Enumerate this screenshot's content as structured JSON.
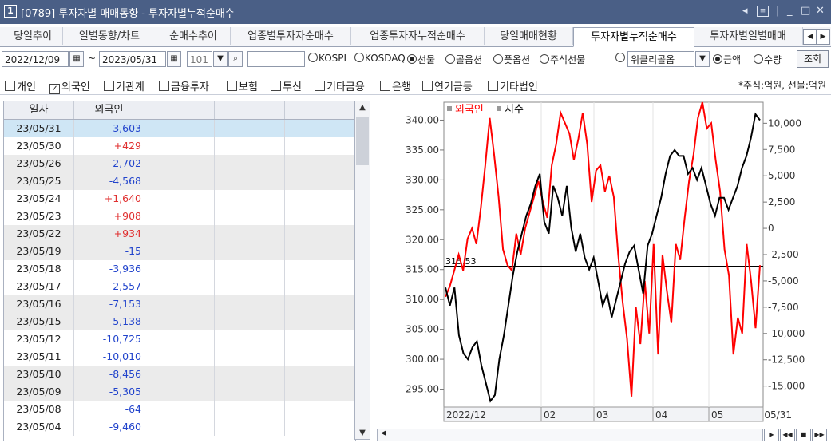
{
  "window": {
    "number": "1",
    "title": "[0789] 투자자별 매매동향 - 투자자별누적순매수"
  },
  "tabs": [
    {
      "label": "당일추이",
      "active": false
    },
    {
      "label": "일별동향/차트",
      "active": false
    },
    {
      "label": "순매수추이",
      "active": false
    },
    {
      "label": "업종별투자자순매수",
      "active": false
    },
    {
      "label": "업종투자자누적순매수",
      "active": false
    },
    {
      "label": "당일매매현황",
      "active": false
    },
    {
      "label": "투자자별누적순매수",
      "active": true
    },
    {
      "label": "투자자별일별매매",
      "active": false
    }
  ],
  "controls": {
    "start_date": "2022/12/09",
    "separator": "~",
    "end_date": "2023/05/31",
    "code": "101",
    "name_field": "",
    "market_options": [
      {
        "label": "KOSPI",
        "selected": false
      },
      {
        "label": "KOSDAQ",
        "selected": false
      },
      {
        "label": "선물",
        "selected": true
      },
      {
        "label": "콜옵션",
        "selected": false
      },
      {
        "label": "풋옵션",
        "selected": false
      },
      {
        "label": "주식선물",
        "selected": false
      }
    ],
    "weekly_option": "위클리콜옵",
    "unit_options": [
      {
        "label": "금액",
        "selected": true
      },
      {
        "label": "수량",
        "selected": false
      }
    ],
    "query_label": "조회"
  },
  "investor_filters": [
    {
      "label": "개인",
      "checked": false
    },
    {
      "label": "외국인",
      "checked": true
    },
    {
      "label": "기관계",
      "checked": false
    },
    {
      "label": "금융투자",
      "checked": false
    },
    {
      "label": "보험",
      "checked": false
    },
    {
      "label": "투신",
      "checked": false
    },
    {
      "label": "기타금융",
      "checked": false
    },
    {
      "label": "은행",
      "checked": false
    },
    {
      "label": "연기금등",
      "checked": false
    },
    {
      "label": "기타법인",
      "checked": false
    }
  ],
  "unit_note": "*주식:억원, 선물:억원",
  "table": {
    "headers": [
      "일자",
      "외국인",
      "",
      "",
      ""
    ],
    "rows": [
      {
        "date": "23/05/31",
        "foreign": "-3,603"
      },
      {
        "date": "23/05/30",
        "foreign": "+429"
      },
      {
        "date": "23/05/26",
        "foreign": "-2,702"
      },
      {
        "date": "23/05/25",
        "foreign": "-4,568"
      },
      {
        "date": "23/05/24",
        "foreign": "+1,640"
      },
      {
        "date": "23/05/23",
        "foreign": "+908"
      },
      {
        "date": "23/05/22",
        "foreign": "+934"
      },
      {
        "date": "23/05/19",
        "foreign": "-15"
      },
      {
        "date": "23/05/18",
        "foreign": "-3,936"
      },
      {
        "date": "23/05/17",
        "foreign": "-2,557"
      },
      {
        "date": "23/05/16",
        "foreign": "-7,153"
      },
      {
        "date": "23/05/15",
        "foreign": "-5,138"
      },
      {
        "date": "23/05/12",
        "foreign": "-10,725"
      },
      {
        "date": "23/05/11",
        "foreign": "-10,010"
      },
      {
        "date": "23/05/10",
        "foreign": "-8,456"
      },
      {
        "date": "23/05/09",
        "foreign": "-5,305"
      },
      {
        "date": "23/05/08",
        "foreign": "-64"
      },
      {
        "date": "23/05/04",
        "foreign": "-9,460"
      }
    ]
  },
  "chart_data": {
    "type": "line",
    "series": [
      {
        "name": "외국인",
        "color": "#ff0000",
        "axis": "right"
      },
      {
        "name": "지수",
        "color": "#000000",
        "axis": "left"
      }
    ],
    "x_ticks": [
      "2022/12",
      "02",
      "03",
      "04",
      "05",
      "05/31"
    ],
    "left_ticks": [
      "340.00",
      "335.00",
      "330.00",
      "325.00",
      "320.00",
      "315.00",
      "310.00",
      "305.00",
      "300.00",
      "295.00"
    ],
    "right_ticks": [
      "10,000",
      "7,500",
      "5,000",
      "2,500",
      "0",
      "-2,500",
      "-5,000",
      "-7,500",
      "-10,000",
      "-12,500",
      "-15,000"
    ],
    "left_range": [
      292,
      343
    ],
    "right_range": [
      -17000,
      12000
    ],
    "reference_label": "315.53",
    "reference_value": 315.53,
    "index_values": [
      312,
      309,
      312,
      304,
      301,
      300,
      302,
      303,
      299,
      296,
      293,
      294,
      300,
      304,
      309,
      314,
      318,
      321,
      324,
      326,
      329,
      331,
      323,
      321,
      329,
      327,
      324,
      329,
      322,
      318,
      321,
      317,
      315,
      317,
      313,
      309,
      311,
      307,
      310,
      313,
      316,
      318,
      319,
      315,
      311,
      319,
      321,
      324,
      327,
      331,
      334,
      335,
      334,
      334,
      331,
      332,
      330,
      332,
      329,
      326,
      324,
      327,
      327,
      325,
      327,
      329,
      332,
      334,
      337,
      341,
      340
    ],
    "foreign_values": [
      -6500,
      -5500,
      -4000,
      -2500,
      -4000,
      -1000,
      0,
      -1500,
      2000,
      6000,
      10500,
      7000,
      3000,
      -2000,
      -3500,
      -4000,
      -500,
      -2500,
      0,
      1500,
      3000,
      4500,
      2500,
      1000,
      6000,
      8000,
      11000,
      10000,
      9000,
      6500,
      8500,
      11000,
      8000,
      2500,
      5500,
      6000,
      3500,
      5000,
      3000,
      -2500,
      -7000,
      -10500,
      -16000,
      -7500,
      -11000,
      -5000,
      -10000,
      -1500,
      -12000,
      -2500,
      -6000,
      -9000,
      -1500,
      -3000,
      1000,
      4500,
      7000,
      10500,
      12000,
      9500,
      10000,
      6500,
      3500,
      -2000,
      -4500,
      -12000,
      -8500,
      -10000,
      -1500,
      -5000,
      -9500,
      -3500
    ]
  }
}
